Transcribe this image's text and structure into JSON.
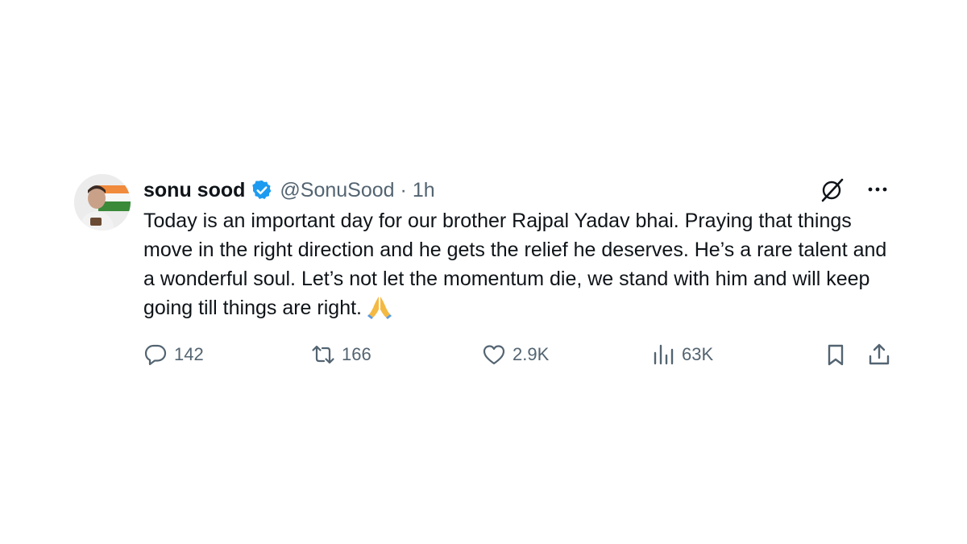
{
  "tweet": {
    "display_name": "sonu sood",
    "handle": "@SonuSood",
    "separator": "·",
    "time": "1h",
    "text": "Today is an important day for our brother Rajpal Yadav bhai. Praying that things move in the right direction and he gets the relief he deserves. He’s a rare talent and a wonderful soul. Let’s not let the momentum die, we stand with him and will keep going till things are right.",
    "emoji": "folded-hands",
    "verified": true
  },
  "icons": {
    "grok": "grok-icon",
    "more": "more-icon",
    "reply": "reply-icon",
    "repost": "repost-icon",
    "like": "heart-icon",
    "views": "views-icon",
    "bookmark": "bookmark-icon",
    "share": "share-icon"
  },
  "stats": {
    "replies": "142",
    "reposts": "166",
    "likes": "2.9K",
    "views": "63K"
  },
  "colors": {
    "text": "#0f1419",
    "secondary": "#536471",
    "verified_blue": "#1d9bf0",
    "background": "#ffffff"
  }
}
